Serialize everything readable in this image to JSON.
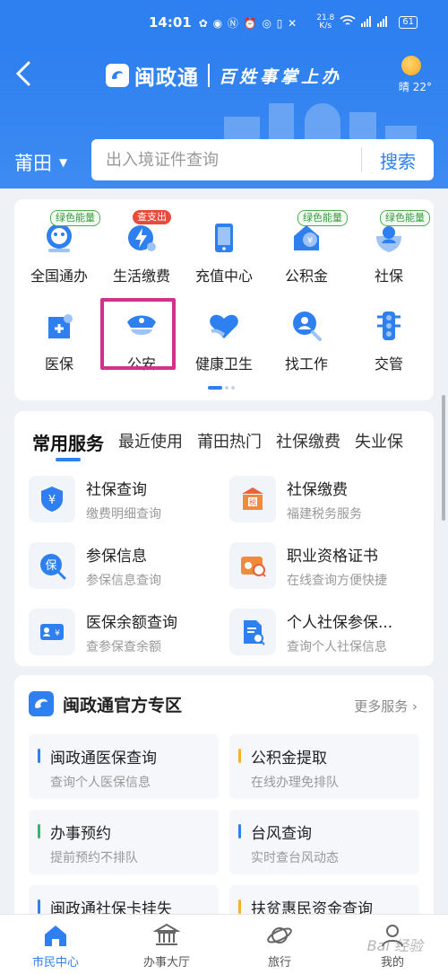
{
  "status_bar": {
    "time": "14:01",
    "net_speed_top": "21.8",
    "net_speed_bottom": "K/s",
    "battery": "61"
  },
  "header": {
    "app_name": "闽政通",
    "slogan": "百姓事掌上办",
    "weather_text": "晴 22°",
    "city": "莆田",
    "search_placeholder": "出入境证件查询",
    "search_button": "搜索"
  },
  "grid": {
    "items": [
      {
        "label": "全国通办",
        "badge": "绿色能量",
        "badge_type": "green",
        "icon": "globe-service-icon"
      },
      {
        "label": "生活缴费",
        "badge": "查支出",
        "badge_type": "red",
        "icon": "lightning-payment-icon"
      },
      {
        "label": "充值中心",
        "badge": "",
        "badge_type": "",
        "icon": "phone-recharge-icon"
      },
      {
        "label": "公积金",
        "badge": "绿色能量",
        "badge_type": "green",
        "icon": "housing-fund-icon"
      },
      {
        "label": "社保",
        "badge": "绿色能量",
        "badge_type": "green",
        "icon": "social-security-icon"
      },
      {
        "label": "医保",
        "badge": "",
        "badge_type": "",
        "icon": "medical-insurance-icon"
      },
      {
        "label": "公安",
        "badge": "",
        "badge_type": "",
        "icon": "police-cap-icon"
      },
      {
        "label": "健康卫生",
        "badge": "",
        "badge_type": "",
        "icon": "health-heart-icon"
      },
      {
        "label": "找工作",
        "badge": "",
        "badge_type": "",
        "icon": "job-search-icon"
      },
      {
        "label": "交管",
        "badge": "",
        "badge_type": "",
        "icon": "traffic-light-icon"
      }
    ]
  },
  "services": {
    "tabs": [
      "常用服务",
      "最近使用",
      "莆田热门",
      "社保缴费",
      "失业保"
    ],
    "items": [
      {
        "title": "社保查询",
        "subtitle": "缴费明细查询",
        "icon": "shield-yuan-icon"
      },
      {
        "title": "社保缴费",
        "subtitle": "福建税务服务",
        "icon": "tax-building-icon"
      },
      {
        "title": "参保信息",
        "subtitle": "参保信息查询",
        "icon": "insurance-search-icon"
      },
      {
        "title": "职业资格证书",
        "subtitle": "在线查询方便快捷",
        "icon": "certificate-icon"
      },
      {
        "title": "医保余额查询",
        "subtitle": "查参保查余额",
        "icon": "medical-card-icon"
      },
      {
        "title": "个人社保参保...",
        "subtitle": "查询个人社保信息",
        "icon": "document-search-icon"
      }
    ]
  },
  "official": {
    "title": "闽政通官方专区",
    "more": "更多服务",
    "items": [
      {
        "title": "闽政通医保查询",
        "subtitle": "查询个人医保信息",
        "color": "#2e7ff0"
      },
      {
        "title": "公积金提取",
        "subtitle": "在线办理免排队",
        "color": "#f5b323"
      },
      {
        "title": "办事预约",
        "subtitle": "提前预约不排队",
        "color": "#3cb371"
      },
      {
        "title": "台风查询",
        "subtitle": "实时查台风动态",
        "color": "#2e7ff0"
      },
      {
        "title": "闽政通社保卡挂失",
        "subtitle": "",
        "color": "#2e7ff0"
      },
      {
        "title": "扶贫惠民资金查询",
        "subtitle": "",
        "color": "#f5b323"
      }
    ]
  },
  "tabbar": {
    "items": [
      {
        "label": "市民中心",
        "icon": "home-icon"
      },
      {
        "label": "办事大厅",
        "icon": "government-hall-icon"
      },
      {
        "label": "旅行",
        "icon": "travel-planet-icon"
      },
      {
        "label": "我的",
        "icon": "user-icon"
      }
    ]
  },
  "watermark": "Bai 经验",
  "colors": {
    "primary": "#2e7ff0",
    "highlight_box": "#d0318a",
    "badge_red": "#e84b3c",
    "badge_green": "#4caf50"
  }
}
